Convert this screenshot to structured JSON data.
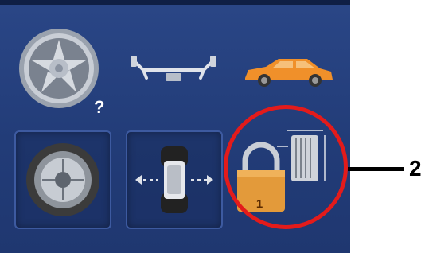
{
  "screen": {
    "tiles": [
      {
        "name": "rim-unknown",
        "icon": "rim-question-icon",
        "label": "?"
      },
      {
        "name": "axle",
        "icon": "axle-icon"
      },
      {
        "name": "vehicle",
        "icon": "car-icon"
      },
      {
        "name": "wheel-balance",
        "icon": "wheel-hub-icon"
      },
      {
        "name": "balance-planes",
        "icon": "tire-planes-icon"
      },
      {
        "name": "lock-dimensions",
        "icon": "padlock-dimensions-icon",
        "label": "1"
      }
    ]
  },
  "callout": {
    "label": "2",
    "color": "#e31b1b"
  },
  "colors": {
    "screen_bg": "#243f7e",
    "car": "#f0902a",
    "lock": "#e39a3a"
  }
}
